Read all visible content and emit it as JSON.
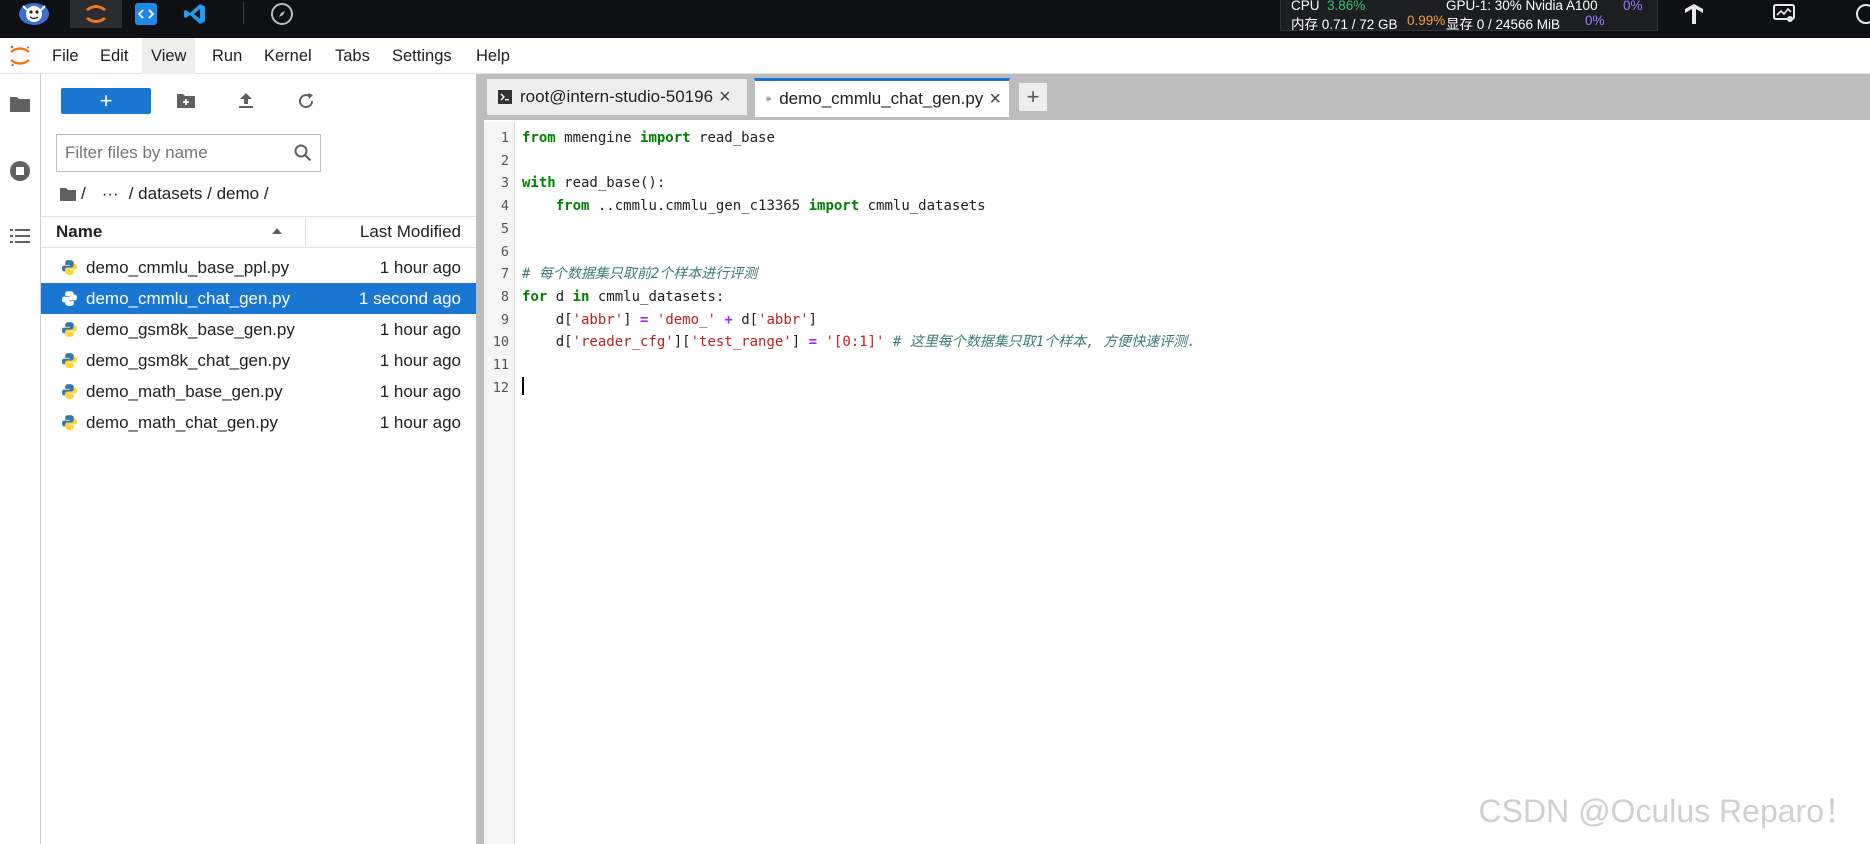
{
  "system_bar": {
    "stats": {
      "cpu_label": "CPU",
      "cpu_value": "3.86%",
      "gpu_label": "GPU-1: 30% Nvidia A100",
      "gpu_value": "0%",
      "mem_label": "内存 0.71 / 72 GB",
      "mem_value": "0.99%",
      "vram_label": "显存 0 / 24566 MiB",
      "vram_value": "0%"
    },
    "apps": [
      "mascot-icon",
      "jupyter-icon",
      "code-server-icon",
      "vscode-icon",
      "compass-icon"
    ]
  },
  "menubar": {
    "items": [
      "File",
      "Edit",
      "View",
      "Run",
      "Kernel",
      "Tabs",
      "Settings",
      "Help"
    ],
    "active": "View"
  },
  "filebrowser": {
    "new_button_label": "+",
    "filter_placeholder": "Filter files by name",
    "breadcrumb": {
      "root": "/",
      "ellipsis": "···",
      "path": "/ datasets / demo /"
    },
    "columns": {
      "name": "Name",
      "modified": "Last Modified"
    },
    "files": [
      {
        "name": "demo_cmmlu_base_ppl.py",
        "modified": "1 hour ago"
      },
      {
        "name": "demo_cmmlu_chat_gen.py",
        "modified": "1 second ago"
      },
      {
        "name": "demo_gsm8k_base_gen.py",
        "modified": "1 hour ago"
      },
      {
        "name": "demo_gsm8k_chat_gen.py",
        "modified": "1 hour ago"
      },
      {
        "name": "demo_math_base_gen.py",
        "modified": "1 hour ago"
      },
      {
        "name": "demo_math_chat_gen.py",
        "modified": "1 hour ago"
      }
    ],
    "selected_file": "demo_cmmlu_chat_gen.py"
  },
  "tabs": [
    {
      "label": "root@intern-studio-50196",
      "type": "terminal"
    },
    {
      "label": "demo_cmmlu_chat_gen.py",
      "type": "editor",
      "current": true
    }
  ],
  "add_tab_label": "+",
  "editor": {
    "line_numbers": [
      "1",
      "2",
      "3",
      "4",
      "5",
      "6",
      "7",
      "8",
      "9",
      "10",
      "11",
      "12"
    ],
    "lines": [
      [
        {
          "t": "from",
          "c": "kw"
        },
        {
          "t": " mmengine "
        },
        {
          "t": "import",
          "c": "kw"
        },
        {
          "t": " read_base"
        }
      ],
      [],
      [
        {
          "t": "with",
          "c": "kw"
        },
        {
          "t": " read_base():"
        }
      ],
      [
        {
          "t": "    "
        },
        {
          "t": "from",
          "c": "kw"
        },
        {
          "t": " ..cmmlu.cmmlu_gen_c13365 "
        },
        {
          "t": "import",
          "c": "kw"
        },
        {
          "t": " cmmlu_datasets"
        }
      ],
      [],
      [],
      [
        {
          "t": "# 每个数据集只取前2个样本进行评测",
          "c": "cm"
        }
      ],
      [
        {
          "t": "for",
          "c": "kw"
        },
        {
          "t": " d "
        },
        {
          "t": "in",
          "c": "kw"
        },
        {
          "t": " cmmlu_datasets:"
        }
      ],
      [
        {
          "t": "    d["
        },
        {
          "t": "'abbr'",
          "c": "str"
        },
        {
          "t": "] "
        },
        {
          "t": "=",
          "c": "op"
        },
        {
          "t": " "
        },
        {
          "t": "'demo_'",
          "c": "str"
        },
        {
          "t": " "
        },
        {
          "t": "+",
          "c": "op"
        },
        {
          "t": " d["
        },
        {
          "t": "'abbr'",
          "c": "str"
        },
        {
          "t": "]"
        }
      ],
      [
        {
          "t": "    d["
        },
        {
          "t": "'reader_cfg'",
          "c": "str"
        },
        {
          "t": "]["
        },
        {
          "t": "'test_range'",
          "c": "str"
        },
        {
          "t": "] "
        },
        {
          "t": "=",
          "c": "op"
        },
        {
          "t": " "
        },
        {
          "t": "'[0:1]'",
          "c": "str"
        },
        {
          "t": " "
        },
        {
          "t": "# 这里每个数据集只取1个样本, 方便快速评测.",
          "c": "cm"
        }
      ],
      [],
      []
    ]
  },
  "watermark": "CSDN @Oculus Reparo！"
}
